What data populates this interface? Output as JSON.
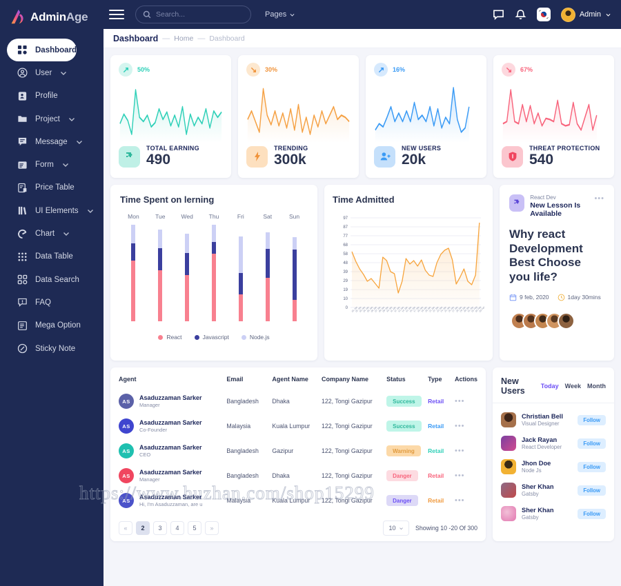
{
  "brand": {
    "name_bold": "Admin",
    "name_light": "Age",
    "logo_icon": "a-logo-icon"
  },
  "topbar": {
    "search_placeholder": "Search...",
    "search_value": "",
    "pages_label": "Pages",
    "admin_label": "Admin",
    "icons": [
      "message-icon",
      "bell-icon",
      "flag-icon"
    ]
  },
  "page_header": {
    "title": "Dashboard",
    "crumb_home": "Home",
    "crumb_current": "Dashboard",
    "separator": "—"
  },
  "sidebar": {
    "items": [
      {
        "label": "Dashboard",
        "icon": "grid-icon",
        "active": true,
        "expandable": false
      },
      {
        "label": "User",
        "icon": "user-circle-icon",
        "active": false,
        "expandable": true
      },
      {
        "label": "Profile",
        "icon": "id-card-icon",
        "active": false,
        "expandable": false
      },
      {
        "label": "Project",
        "icon": "folder-icon",
        "active": false,
        "expandable": true
      },
      {
        "label": "Message",
        "icon": "chat-icon",
        "active": false,
        "expandable": true
      },
      {
        "label": "Form",
        "icon": "form-icon",
        "active": false,
        "expandable": true
      },
      {
        "label": "Price Table",
        "icon": "price-list-icon",
        "active": false,
        "expandable": false
      },
      {
        "label": "UI Elements",
        "icon": "books-icon",
        "active": false,
        "expandable": true
      },
      {
        "label": "Chart",
        "icon": "pie-chart-icon",
        "active": false,
        "expandable": true
      },
      {
        "label": "Data Table",
        "icon": "dots-grid-icon",
        "active": false,
        "expandable": false
      },
      {
        "label": "Data Search",
        "icon": "grid-icon",
        "active": false,
        "expandable": false
      },
      {
        "label": "FAQ",
        "icon": "question-chat-icon",
        "active": false,
        "expandable": false
      },
      {
        "label": "Mega Option",
        "icon": "list-box-icon",
        "active": false,
        "expandable": false
      },
      {
        "label": "Sticky Note",
        "icon": "note-icon",
        "active": false,
        "expandable": false
      }
    ]
  },
  "stats": [
    {
      "pct": "50%",
      "label": "TOTAL EARNING",
      "value": "490",
      "icon": "puzzle-icon",
      "trend": "up",
      "color": "#2fd0b8",
      "soft": "#d4f5ef"
    },
    {
      "pct": "30%",
      "label": "TRENDING",
      "value": "300k",
      "icon": "bolt-icon",
      "trend": "down",
      "color": "#f5a council",
      "soft": "#fde8cf"
    },
    {
      "pct": "16%",
      "label": "NEW USERS",
      "value": "20k",
      "icon": "user-plus-icon",
      "trend": "up",
      "color": "#3b9bf5",
      "soft": "#d6e9fd"
    },
    {
      "pct": "67%",
      "label": "THREAT PROTECTION",
      "value": "540",
      "icon": "shield-icon",
      "trend": "down",
      "color": "#f8647c",
      "soft": "#fdd8de"
    }
  ],
  "learning": {
    "title": "Time Spent on lerning",
    "legend": [
      {
        "name": "React",
        "color": "#f8808f"
      },
      {
        "name": "Javascript",
        "color": "#3b3f9e"
      },
      {
        "name": "Node.js",
        "color": "#ccd0f5"
      }
    ]
  },
  "admitted": {
    "title": "Time Admitted"
  },
  "lesson": {
    "source": "React Dev",
    "available": "New Lesson Is Available",
    "headline": "Why react Development Best Choose you life?",
    "date": "9 feb, 2020",
    "duration": "1day 30mins",
    "menu": "•••"
  },
  "table": {
    "columns": [
      "Agent",
      "",
      "Email",
      "Agent Name",
      "Company Name",
      "Status",
      "Type",
      "Actions"
    ],
    "rows": [
      {
        "initials": "AS",
        "av_color": "#5b61a8",
        "name": "Asaduzzaman Sarker",
        "role": "Manager",
        "email": "Bangladesh",
        "agent_name": "Dhaka",
        "company": "122, Tongi Gazipur",
        "status": "Success",
        "status_bg": "#bff5e8",
        "status_fg": "#2fb89c",
        "type": "Retail",
        "type_color": "#6c4ff5",
        "actions": "•••"
      },
      {
        "initials": "AS",
        "av_color": "#3f45cf",
        "name": "Asaduzzaman Sarker",
        "role": "Co-Founder",
        "email": "Malaysia",
        "agent_name": "Kuala Lumpur",
        "company": "122, Tongi Gazipur",
        "status": "Success",
        "status_bg": "#bff5e8",
        "status_fg": "#2fb89c",
        "type": "Retail",
        "type_color": "#3b9bf5",
        "actions": "•••"
      },
      {
        "initials": "AS",
        "av_color": "#1fc0b0",
        "name": "Asaduzzaman Sarker",
        "role": "CEO",
        "email": "Bangladesh",
        "agent_name": "Gazipur",
        "company": "122, Tongi Gazipur",
        "status": "Warning",
        "status_bg": "#fcd9a8",
        "status_fg": "#e09a3e",
        "type": "Retail",
        "type_color": "#2fd0b8",
        "actions": "•••"
      },
      {
        "initials": "AS",
        "av_color": "#f0465f",
        "name": "Asaduzzaman Sarker",
        "role": "Manager",
        "email": "Bangladesh",
        "agent_name": "Dhaka",
        "company": "122, Tongi Gazipur",
        "status": "Danger",
        "status_bg": "#fddbe1",
        "status_fg": "#f8647c",
        "type": "Retail",
        "type_color": "#f8647c",
        "actions": "•••"
      },
      {
        "initials": "AS",
        "av_color": "#4b52c9",
        "name": "Asaduzzaman Sarker",
        "role": "Hi, I'm Asaduzzaman, are u",
        "email": "Malaysia",
        "agent_name": "Kuala Lumpur",
        "company": "122, Tongi Gazipur",
        "status": "Danger",
        "status_bg": "#ddd9f7",
        "status_fg": "#6c4ff5",
        "type": "Retail",
        "type_color": "#f09a3e",
        "actions": "•••"
      }
    ],
    "pagination": {
      "prev": "«",
      "next": "»",
      "pages": [
        "2",
        "3",
        "4",
        "5"
      ],
      "active_page": "2",
      "page_size": "10",
      "showing": "Showing 10 -20 Of 300"
    }
  },
  "new_users": {
    "title": "New Users",
    "tabs": [
      {
        "label": "Today",
        "active": true
      },
      {
        "label": "Week",
        "active": false
      },
      {
        "label": "Month",
        "active": false
      }
    ],
    "follow_label": "Follow",
    "items": [
      {
        "name": "Christian Bell",
        "role": "Visual Designer",
        "av_color": "#9a6b4a"
      },
      {
        "name": "Jack Rayan",
        "role": "React Developer",
        "av_color": "#6d3b8e"
      },
      {
        "name": "Jhon Doe",
        "role": "Node Js",
        "av_color": "#f2b233"
      },
      {
        "name": "Sher Khan",
        "role": "Gatsby",
        "av_color": "#7b5a72"
      },
      {
        "name": "Sher Khan",
        "role": "Gatsby",
        "av_color": "#e79ec2"
      }
    ]
  },
  "watermark": "https://www.huzhan.com/shop15299",
  "chart_data": [
    {
      "type": "bar",
      "title": "Time Spent on lerning",
      "categories": [
        "Mon",
        "Tue",
        "Wed",
        "Thu",
        "Fri",
        "Sat",
        "Sun"
      ],
      "series": [
        {
          "name": "React",
          "color": "#f8808f",
          "values": [
            63,
            53,
            48,
            70,
            28,
            45,
            22
          ]
        },
        {
          "name": "Javascript",
          "color": "#3b3f9e",
          "values": [
            18,
            23,
            23,
            12,
            22,
            30,
            52
          ]
        },
        {
          "name": "Node.js",
          "color": "#ccd0f5",
          "values": [
            19,
            19,
            20,
            18,
            38,
            17,
            13
          ]
        }
      ],
      "stacked": true,
      "ylim": [
        0,
        100
      ],
      "grid": false,
      "legend_position": "bottom"
    },
    {
      "type": "area",
      "title": "Time Admitted",
      "color": "#f7a43c",
      "yticks": [
        0,
        10,
        19,
        29,
        39,
        48,
        58,
        68,
        77,
        87,
        97
      ],
      "ylim": [
        0,
        100
      ],
      "grid": true,
      "xlabel": "",
      "ylabel": "",
      "values": [
        61,
        52,
        44,
        38,
        30,
        33,
        27,
        22,
        53,
        49,
        37,
        35,
        18,
        30,
        52,
        46,
        49,
        44,
        50,
        41,
        36,
        35,
        47,
        56,
        61,
        63,
        50,
        26,
        33,
        41,
        30,
        26,
        35,
        92
      ]
    },
    {
      "type": "line",
      "title": "TOTAL EARNING sparkline",
      "color": "#2fd0b8",
      "values": [
        30,
        45,
        36,
        20,
        75,
        40,
        33,
        42,
        25,
        30,
        50,
        34,
        44,
        27,
        40,
        25,
        50,
        18,
        41,
        28,
        38,
        30,
        48,
        25,
        42
      ]
    },
    {
      "type": "line",
      "title": "TRENDING sparkline",
      "color": "#f5a144",
      "values": [
        35,
        42,
        34,
        22,
        78,
        38,
        32,
        45,
        30,
        42,
        28,
        46,
        24,
        48,
        22,
        36,
        18,
        40,
        30,
        44,
        32,
        40,
        48,
        30,
        34
      ]
    },
    {
      "type": "line",
      "title": "NEW USERS sparkline",
      "color": "#3b9bf5",
      "values": [
        22,
        30,
        26,
        38,
        50,
        34,
        44,
        30,
        42,
        32,
        52,
        36,
        40,
        30,
        48,
        28,
        50,
        24,
        36,
        30,
        82,
        40,
        18,
        26,
        50
      ]
    },
    {
      "type": "line",
      "title": "THREAT PROTECTION sparkline",
      "color": "#f8647c",
      "values": [
        30,
        33,
        80,
        38,
        34,
        58,
        36,
        56,
        34,
        46,
        30,
        40,
        38,
        36,
        62,
        34,
        30,
        32,
        60,
        34,
        28,
        40,
        56,
        26,
        44
      ]
    }
  ]
}
